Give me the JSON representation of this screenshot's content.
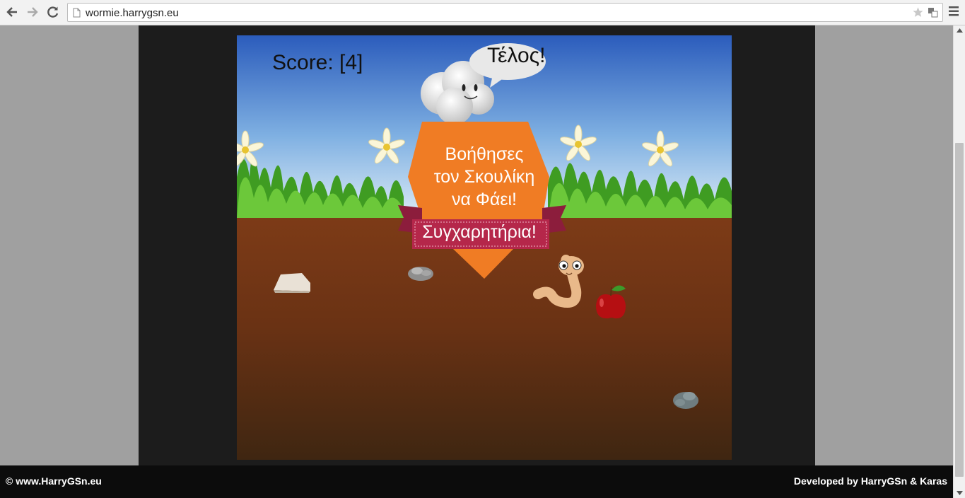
{
  "browser": {
    "url": "wormie.harrygsn.eu"
  },
  "game": {
    "score_text": "Score: [4]",
    "speech_text": "Τέλος!",
    "banner_lines": [
      "Βοήθησες",
      "τον Σκουλίκη",
      "να Φάει!"
    ],
    "ribbon_text": "Συγχαρητήρια!"
  },
  "footer": {
    "left": "© www.HarryGSn.eu",
    "right": "Developed by HarryGSn & Karas"
  },
  "colors": {
    "sky_top": "#2c5fbf",
    "sky_bottom": "#cfe3f4",
    "soil": "#7a3a17",
    "banner": "#f07c24",
    "ribbon": "#b5274a"
  }
}
